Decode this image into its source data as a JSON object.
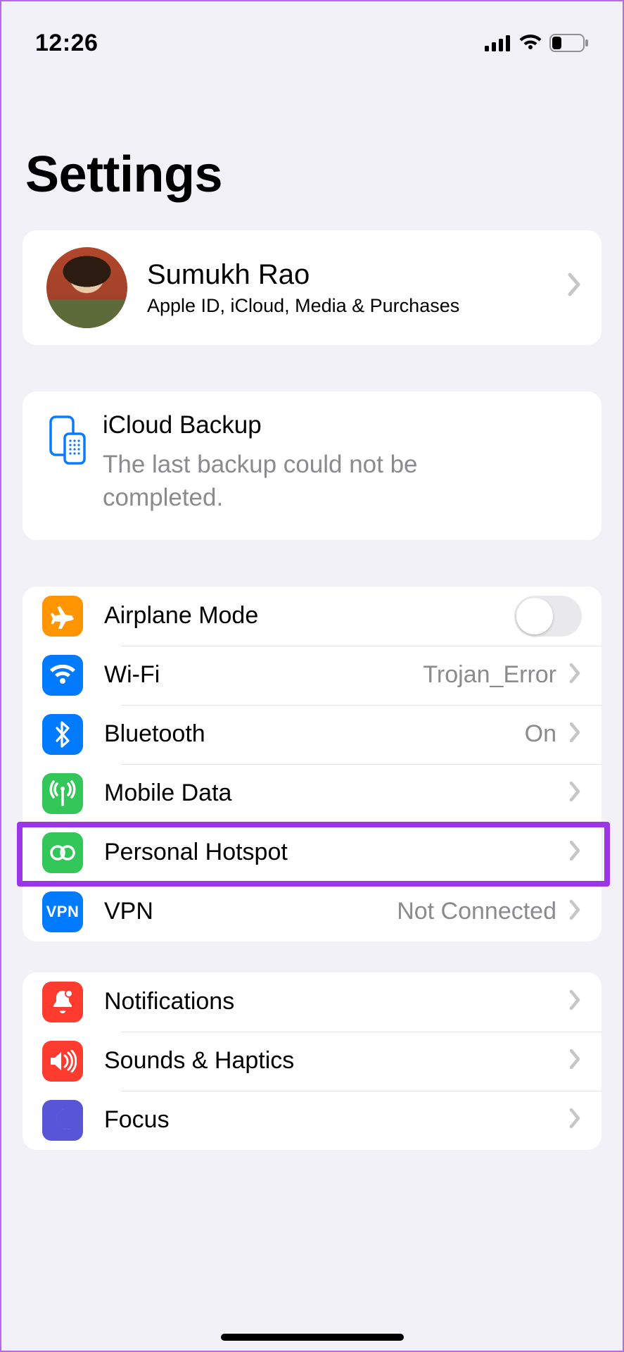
{
  "status": {
    "time": "12:26"
  },
  "title": "Settings",
  "profile": {
    "name": "Sumukh Rao",
    "subtitle": "Apple ID, iCloud, Media & Purchases"
  },
  "backup": {
    "title": "iCloud Backup",
    "message": "The last backup could not be completed."
  },
  "section1": {
    "airplane": {
      "label": "Airplane Mode"
    },
    "wifi": {
      "label": "Wi-Fi",
      "detail": "Trojan_Error"
    },
    "bluetooth": {
      "label": "Bluetooth",
      "detail": "On"
    },
    "mobile": {
      "label": "Mobile Data"
    },
    "hotspot": {
      "label": "Personal Hotspot"
    },
    "vpn": {
      "label": "VPN",
      "detail": "Not Connected",
      "badge": "VPN"
    }
  },
  "section2": {
    "notifications": {
      "label": "Notifications"
    },
    "sounds": {
      "label": "Sounds & Haptics"
    },
    "focus": {
      "label": "Focus"
    }
  }
}
